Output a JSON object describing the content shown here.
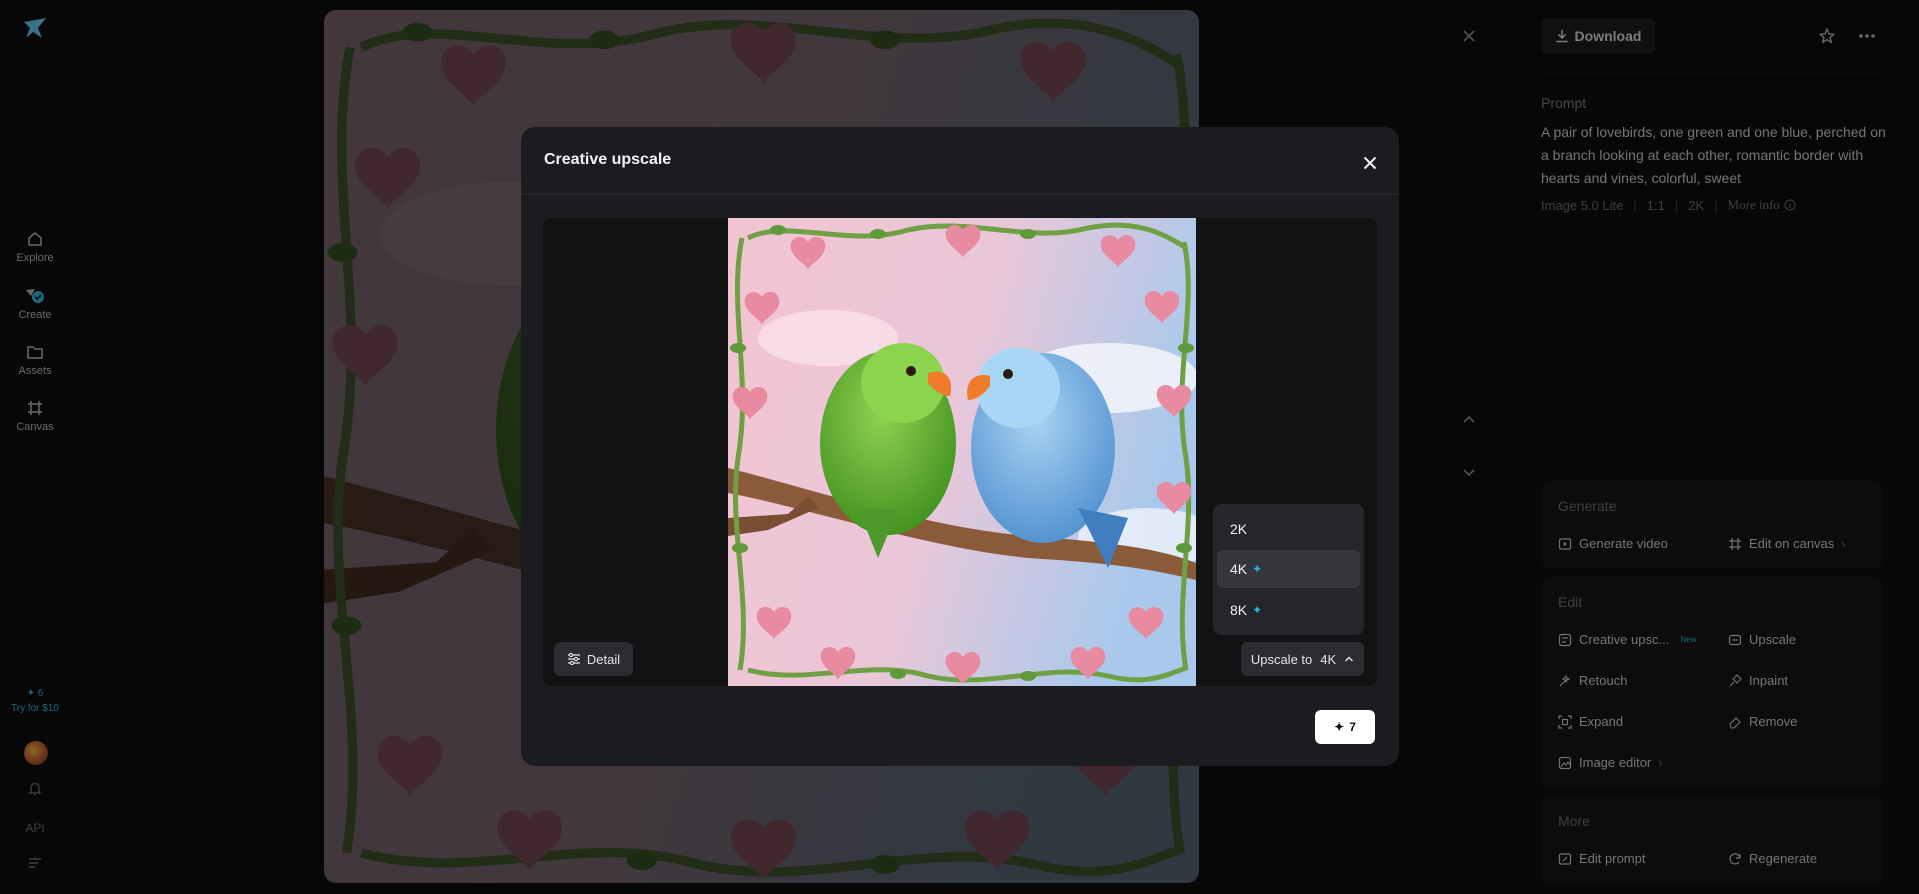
{
  "sidebar": {
    "items": [
      {
        "label": "Explore",
        "icon": "home-icon"
      },
      {
        "label": "Create",
        "icon": "create-icon"
      },
      {
        "label": "Assets",
        "icon": "folder-icon"
      },
      {
        "label": "Canvas",
        "icon": "canvas-icon"
      }
    ],
    "credits": "6",
    "promo": "Try for $10",
    "api": "API"
  },
  "right_panel": {
    "download_label": "Download",
    "prompt_label": "Prompt",
    "prompt_text": "A pair of lovebirds, one green and one blue, perched on a branch looking at each other, romantic border with hearts and vines, colorful, sweet",
    "meta": {
      "model": "Image 5.0 Lite",
      "ratio": "1:1",
      "resolution": "2K",
      "more_info": "More info"
    },
    "generate": {
      "title": "Generate",
      "generate_video": "Generate video",
      "edit_on_canvas": "Edit on canvas"
    },
    "edit": {
      "title": "Edit",
      "creative_upscale": "Creative upsc...",
      "new_badge": "New",
      "upscale": "Upscale",
      "retouch": "Retouch",
      "inpaint": "Inpaint",
      "expand": "Expand",
      "remove": "Remove",
      "image_editor": "Image editor"
    },
    "more": {
      "title": "More",
      "edit_prompt": "Edit prompt",
      "regenerate": "Regenerate"
    }
  },
  "modal": {
    "title": "Creative upscale",
    "detail_label": "Detail",
    "resolution_options": [
      "2K",
      "4K",
      "8K"
    ],
    "selected_resolution": "4K",
    "upscale_prefix": "Upscale to",
    "upscale_value": "4K",
    "cost": "7"
  },
  "colors": {
    "accent": "#2bb6d9",
    "background": "#0d0d0e",
    "modal": "#1b1c1f"
  }
}
